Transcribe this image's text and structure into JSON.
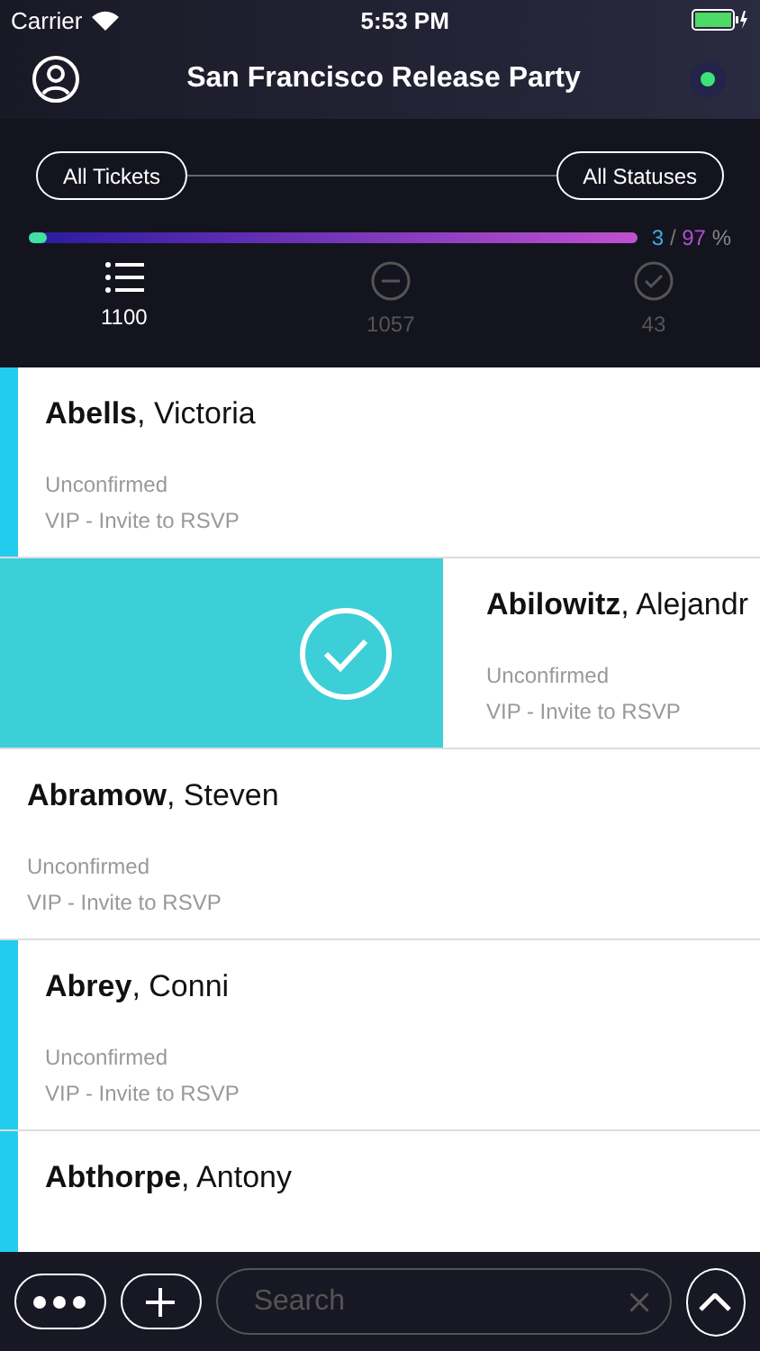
{
  "status_bar": {
    "carrier": "Carrier",
    "time": "5:53 PM"
  },
  "header": {
    "title": "San Francisco Release Party",
    "online": true
  },
  "filters": {
    "left": "All Tickets",
    "right": "All Statuses"
  },
  "progress": {
    "level": 0.03,
    "checked": "3",
    "separator": "/",
    "unchecked": "97",
    "unit": "%"
  },
  "tabs": [
    {
      "kind": "list",
      "count": "1100",
      "selected": true
    },
    {
      "kind": "minus",
      "count": "1057",
      "selected": false
    },
    {
      "kind": "check",
      "count": "43",
      "selected": false
    }
  ],
  "rows": [
    {
      "name": "**Abells**, Victoria",
      "status": "Unconfirmed",
      "ticket": "VIP - Invite to RSVP",
      "flagged": true,
      "swiped": false
    },
    {
      "name": "**Abilowitz**, Alejandr",
      "status": "Unconfirmed",
      "ticket": "VIP - Invite to RSVP",
      "flagged": false,
      "swiped": true
    },
    {
      "name": "**Abramow**, Steven",
      "status": "Unconfirmed",
      "ticket": "VIP - Invite to RSVP",
      "flagged": false,
      "swiped": false
    },
    {
      "name": "**Abrey**, Conni",
      "status": "Unconfirmed",
      "ticket": "VIP - Invite to RSVP",
      "flagged": true,
      "swiped": false
    },
    {
      "name": "**Abthorpe**, Antony",
      "flagged": true,
      "swiped": false
    }
  ],
  "bottom_bar": {
    "search": {
      "placeholder": "Search"
    }
  }
}
